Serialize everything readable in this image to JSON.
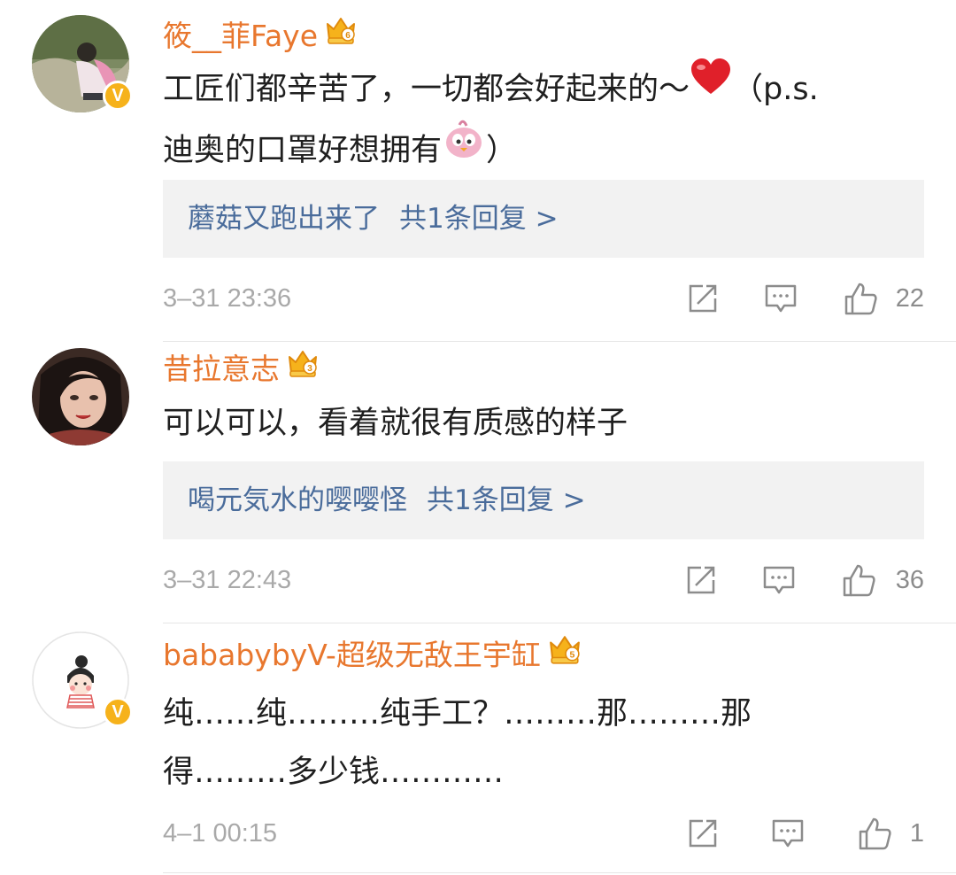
{
  "comments": [
    {
      "username": "筱__菲Faye",
      "vip_level": "6",
      "text_part1": "工匠们都辛苦了，一切都会好起来的～",
      "text_part2": "（p.s.\n迪奥的口罩好想拥有",
      "text_part3": "）",
      "reply_user": "蘑菇又跑出来了",
      "reply_count": "共1条回复 >",
      "time": "3–31 23:36",
      "likes": "22"
    },
    {
      "username": "昔拉意志",
      "vip_level": "3",
      "text": "可以可以，看着就很有质感的样子",
      "reply_user": "喝元気水的嘤嘤怪",
      "reply_count": "共1条回复 >",
      "time": "3–31 22:43",
      "likes": "36"
    },
    {
      "username": "bababybyV-超级无敌王宇缸",
      "vip_level": "5",
      "text": "纯……纯………纯手工？………那………那\n得………多少钱…………",
      "time": "4–1 00:15",
      "likes": "1"
    }
  ],
  "icons": {
    "verified_badge": "V",
    "repost": "repost-icon",
    "comment": "comment-icon",
    "like": "thumbs-up-icon",
    "crown": "crown-icon"
  },
  "colors": {
    "username": "#e8772e",
    "reply_link": "#4a6c9b",
    "verified": "#f6b21b",
    "meta": "#a9a9a9"
  }
}
